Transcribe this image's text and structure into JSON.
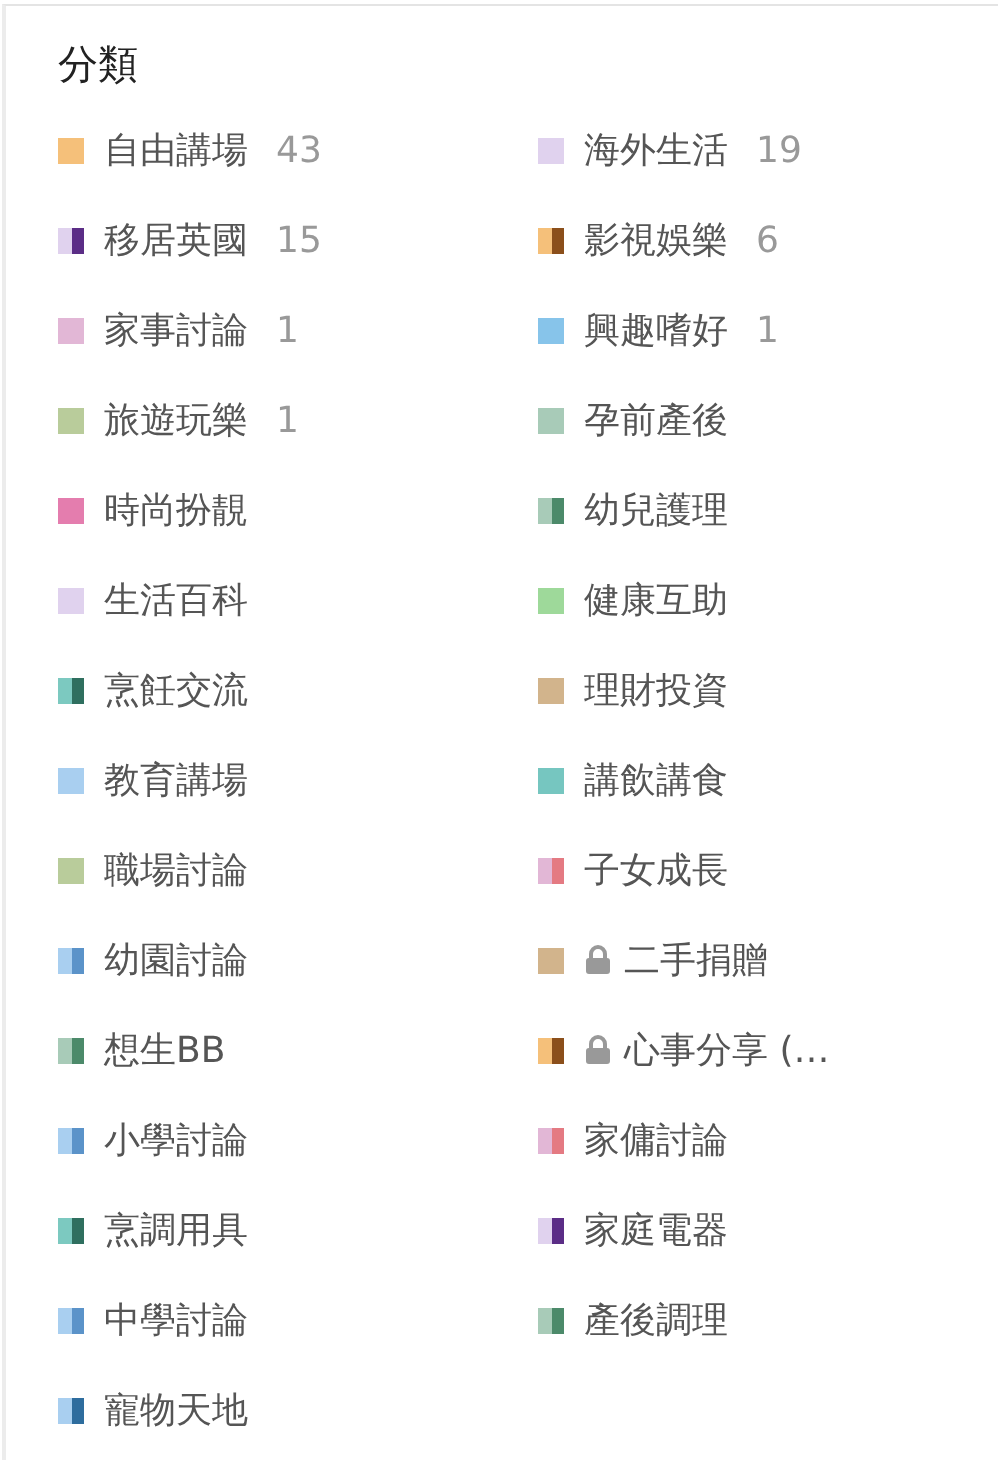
{
  "title": "分類",
  "categories": [
    {
      "name": "自由講場",
      "count": "43",
      "color": "#f5c07a",
      "locked": false
    },
    {
      "name": "海外生活",
      "count": "19",
      "color": "#e0d2ee",
      "locked": false
    },
    {
      "name": "移居英國",
      "count": "15",
      "stripes": [
        {
          "color": "#e0d2ee"
        },
        {
          "color": "#5b2d86"
        }
      ],
      "locked": false
    },
    {
      "name": "影視娛樂",
      "count": "6",
      "stripes": [
        {
          "color": "#f5c07a"
        },
        {
          "color": "#8b4f1b"
        }
      ],
      "locked": false
    },
    {
      "name": "家事討論",
      "count": "1",
      "color": "#e2b7d6",
      "locked": false
    },
    {
      "name": "興趣嗜好",
      "count": "1",
      "color": "#87c4ea",
      "locked": false
    },
    {
      "name": "旅遊玩樂",
      "count": "1",
      "color": "#b9cc9b",
      "locked": false
    },
    {
      "name": "孕前產後",
      "color": "#a8cbb8",
      "locked": false
    },
    {
      "name": "時尚扮靚",
      "color": "#e47dae",
      "locked": false
    },
    {
      "name": "幼兒護理",
      "stripes": [
        {
          "color": "#a8cbb8"
        },
        {
          "color": "#4c8a6a"
        }
      ],
      "locked": false
    },
    {
      "name": "生活百科",
      "color": "#e0d2ee",
      "locked": false
    },
    {
      "name": "健康互助",
      "color": "#9ed99a",
      "locked": false
    },
    {
      "name": "烹飪交流",
      "stripes": [
        {
          "color": "#7cc9c0"
        },
        {
          "color": "#2f6f5f"
        }
      ],
      "locked": false
    },
    {
      "name": "理財投資",
      "color": "#d2b48c",
      "locked": false
    },
    {
      "name": "教育講場",
      "color": "#a9cff0",
      "locked": false
    },
    {
      "name": "講飲講食",
      "color": "#76c6c0",
      "locked": false
    },
    {
      "name": "職場討論",
      "color": "#b9cc9b",
      "locked": false
    },
    {
      "name": "子女成長",
      "stripes": [
        {
          "color": "#e2b7d6"
        },
        {
          "color": "#e47a82"
        }
      ],
      "locked": false
    },
    {
      "name": "幼園討論",
      "stripes": [
        {
          "color": "#a9cff0"
        },
        {
          "color": "#5b93c9"
        }
      ],
      "locked": false
    },
    {
      "name": "二手捐贈",
      "color": "#d2b48c",
      "locked": true
    },
    {
      "name": "想生BB",
      "stripes": [
        {
          "color": "#a8cbb8"
        },
        {
          "color": "#4c8a6a"
        }
      ],
      "locked": false
    },
    {
      "name": "心事分享 (…",
      "stripes": [
        {
          "color": "#f5c07a"
        },
        {
          "color": "#8b4f1b"
        }
      ],
      "locked": true
    },
    {
      "name": "小學討論",
      "stripes": [
        {
          "color": "#a9cff0"
        },
        {
          "color": "#5b93c9"
        }
      ],
      "locked": false
    },
    {
      "name": "家傭討論",
      "stripes": [
        {
          "color": "#e2b7d6"
        },
        {
          "color": "#e47a82"
        }
      ],
      "locked": false
    },
    {
      "name": "烹調用具",
      "stripes": [
        {
          "color": "#7cc9c0"
        },
        {
          "color": "#2f6f5f"
        }
      ],
      "locked": false
    },
    {
      "name": "家庭電器",
      "stripes": [
        {
          "color": "#e0d2ee"
        },
        {
          "color": "#5b2d86"
        }
      ],
      "locked": false
    },
    {
      "name": "中學討論",
      "stripes": [
        {
          "color": "#a9cff0"
        },
        {
          "color": "#5b93c9"
        }
      ],
      "locked": false
    },
    {
      "name": "產後調理",
      "stripes": [
        {
          "color": "#a8cbb8"
        },
        {
          "color": "#4c8a6a"
        }
      ],
      "locked": false
    },
    {
      "name": "寵物天地",
      "stripes": [
        {
          "color": "#a9cff0"
        },
        {
          "color": "#2e6d9e"
        }
      ],
      "locked": false
    }
  ]
}
